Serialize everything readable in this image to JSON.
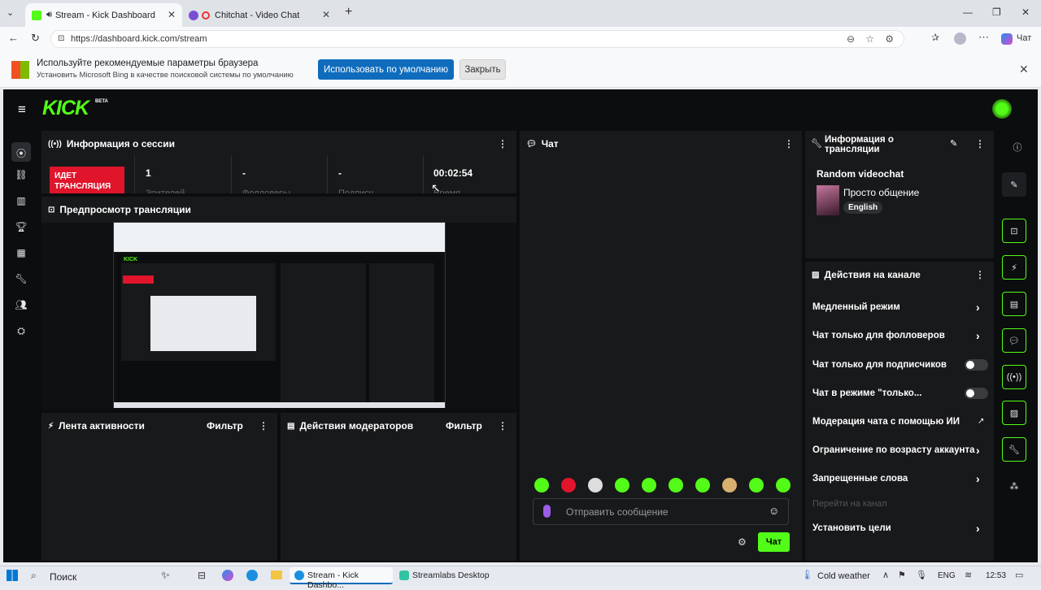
{
  "browser": {
    "tabs": [
      {
        "title": "Stream - Kick Dashboard"
      },
      {
        "title": "Chitchat - Video Chat"
      }
    ],
    "url": "https://dashboard.kick.com/stream",
    "copilot_label": "Чат"
  },
  "infobar": {
    "title": "Используйте рекомендуемые параметры браузера",
    "subtitle": "Установить Microsoft Bing в качестве поисковой системы по умолчанию",
    "primary_btn": "Использовать по умолчанию",
    "secondary_btn": "Закрыть"
  },
  "app": {
    "logo": "KICK",
    "logo_badge": "BETA",
    "session": {
      "title": "Информация о сессии",
      "live_badge": "ИДЕТ ТРАНСЛЯЦИЯ",
      "viewers": "1",
      "viewers_label": "Зрителей",
      "followers": "-",
      "followers_label": "Фолловеры",
      "subs": "-",
      "subs_label": "Подписч.",
      "uptime": "00:02:54",
      "uptime_label": "Время"
    },
    "preview": {
      "title": "Предпросмотр трансляции"
    },
    "activity": {
      "title": "Лента активности",
      "filter": "Фильтр"
    },
    "modactions": {
      "title": "Действия модераторов",
      "filter": "Фильтр"
    },
    "chat": {
      "title": "Чат",
      "placeholder": "Отправить сообщение",
      "send": "Чат"
    },
    "streaminfo": {
      "title": "Информация о трансляции",
      "stream_title": "Random videochat",
      "category": "Просто общение",
      "language": "English"
    },
    "channel_actions": {
      "title": "Действия на канале",
      "items": [
        {
          "label": "Медленный режим"
        },
        {
          "label": "Чат только для фолловеров"
        },
        {
          "label": "Чат только для подписчиков"
        },
        {
          "label": "Чат в режиме \"только..."
        },
        {
          "label": "Модерация чата с помощью ИИ"
        },
        {
          "label": "Ограничение по возрасту аккаунта"
        },
        {
          "label": "Запрещенные слова"
        },
        {
          "label": "Перейти на канал"
        },
        {
          "label": "Установить цели"
        }
      ]
    }
  },
  "taskbar": {
    "search": "Поиск",
    "app1": "Stream - Kick Dashbo...",
    "app2": "Streamlabs Desktop",
    "weather": "Cold weather",
    "lang": "ENG",
    "time": "12:53"
  }
}
